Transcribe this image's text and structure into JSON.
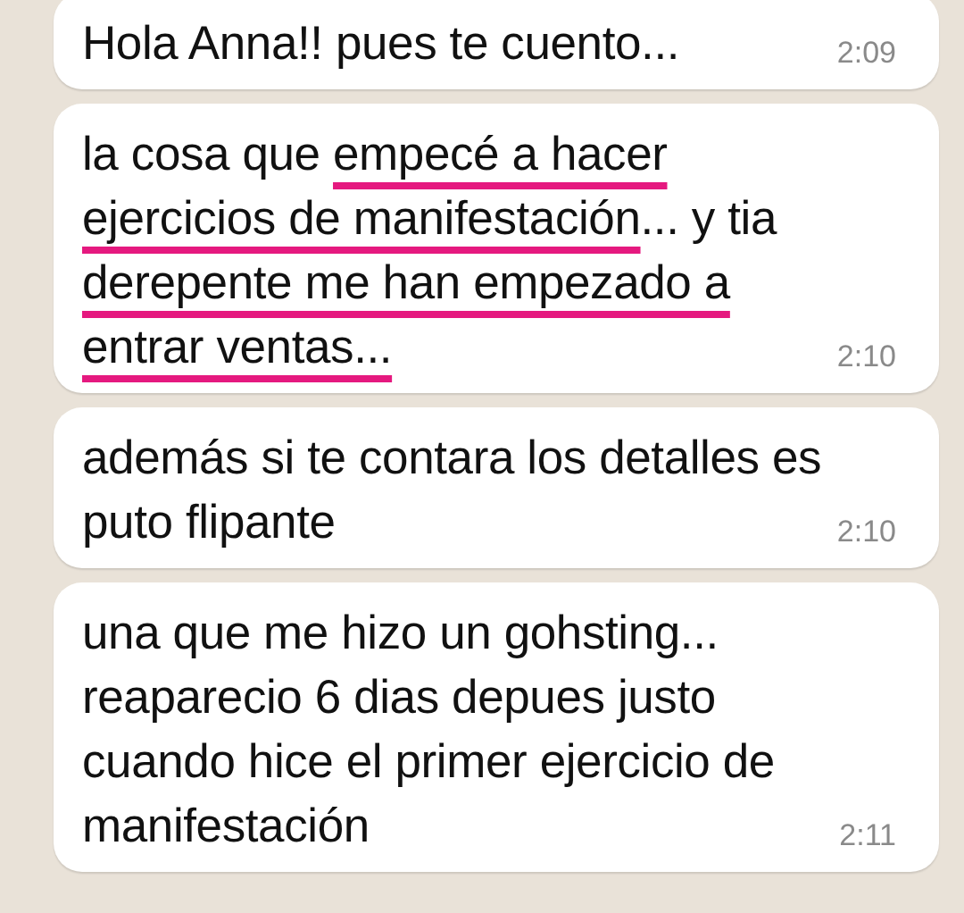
{
  "messages": [
    {
      "segments": [
        {
          "text": "Hola Anna!! pues te cuento...",
          "highlighted": false
        }
      ],
      "time": "2:09"
    },
    {
      "segments": [
        {
          "text": "la cosa que ",
          "highlighted": false
        },
        {
          "text": "empecé a hacer ejercicios de manifestación",
          "highlighted": true
        },
        {
          "text": "... y tia ",
          "highlighted": false
        },
        {
          "text": "derepente me han empezado a entrar ventas...",
          "highlighted": true
        }
      ],
      "time": "2:10"
    },
    {
      "segments": [
        {
          "text": "además si te contara los detalles es puto flipante",
          "highlighted": false
        }
      ],
      "time": "2:10"
    },
    {
      "segments": [
        {
          "text": "una que me hizo un gohsting... reaparecio 6 dias depues justo cuando hice el primer ejercicio de manifestación",
          "highlighted": false
        }
      ],
      "time": "2:11"
    }
  ]
}
